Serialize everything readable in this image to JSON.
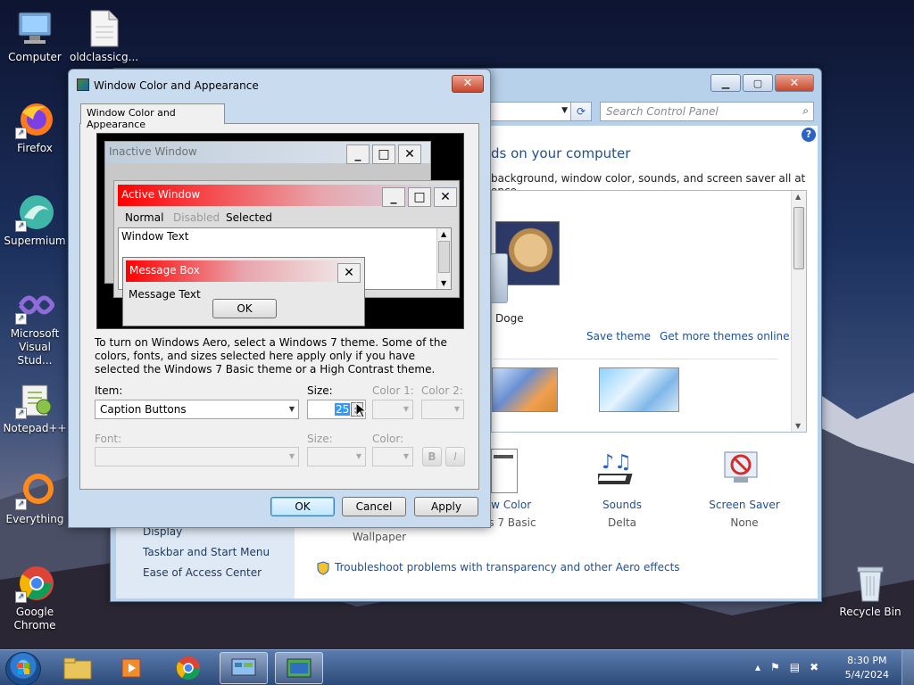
{
  "desktop": {
    "icons": [
      {
        "label": "Computer",
        "icon": "computer-icon"
      },
      {
        "label": "oldclassicg...",
        "icon": "file-icon"
      },
      {
        "label": "Firefox",
        "icon": "firefox-icon"
      },
      {
        "label": "Supermium",
        "icon": "supermium-icon"
      },
      {
        "label": "Microsoft Visual Stud...",
        "icon": "visual-studio-icon"
      },
      {
        "label": "Notepad++",
        "icon": "notepadpp-icon"
      },
      {
        "label": "Everything",
        "icon": "everything-icon"
      },
      {
        "label": "Google Chrome",
        "icon": "chrome-icon"
      },
      {
        "label": "Recycle Bin",
        "icon": "recycle-bin-icon"
      }
    ]
  },
  "control_panel": {
    "search_placeholder": "Search Control Panel",
    "heading": "ds on your computer",
    "subheading": "background, window color, sounds, and screen saver all at once.",
    "theme_name": "Doge",
    "save_theme": "Save theme",
    "get_more": "Get more themes online",
    "sidebar": [
      "Display",
      "Taskbar and Start Menu",
      "Ease of Access Center"
    ],
    "bottom": [
      {
        "label": "ow Color",
        "sub": "ws 7 Basic"
      },
      {
        "label": "Sounds",
        "sub": "Delta"
      },
      {
        "label": "Screen Saver",
        "sub": "None"
      }
    ],
    "wallpaper_sub": "Wallpaper",
    "troubleshoot": "Troubleshoot problems with transparency and other Aero effects"
  },
  "dialog": {
    "title": "Window Color and Appearance",
    "tab": "Window Color and Appearance",
    "preview": {
      "inactive": "Inactive Window",
      "active": "Active Window",
      "menu_normal": "Normal",
      "menu_disabled": "Disabled",
      "menu_selected": "Selected",
      "window_text": "Window Text",
      "msgbox": "Message Box",
      "msg_text": "Message Text",
      "ok": "OK"
    },
    "info": "To turn on Windows Aero, select a Windows 7 theme.  Some of the colors, fonts, and sizes selected here apply only if you have selected the Windows 7 Basic theme or a High Contrast theme.",
    "item_label": "Item:",
    "item_value": "Caption Buttons",
    "size_label": "Size:",
    "size_value": "25",
    "color1_label": "Color 1:",
    "color2_label": "Color 2:",
    "font_label": "Font:",
    "font_size_label": "Size:",
    "font_color_label": "Color:",
    "bold": "B",
    "italic": "I",
    "ok": "OK",
    "cancel": "Cancel",
    "apply": "Apply"
  },
  "taskbar": {
    "time": "8:30 PM",
    "date": "5/4/2024"
  },
  "colors": {
    "active_title_start": "#ff0000",
    "inactive_title": "#bfcddb",
    "link": "#1e5096"
  }
}
